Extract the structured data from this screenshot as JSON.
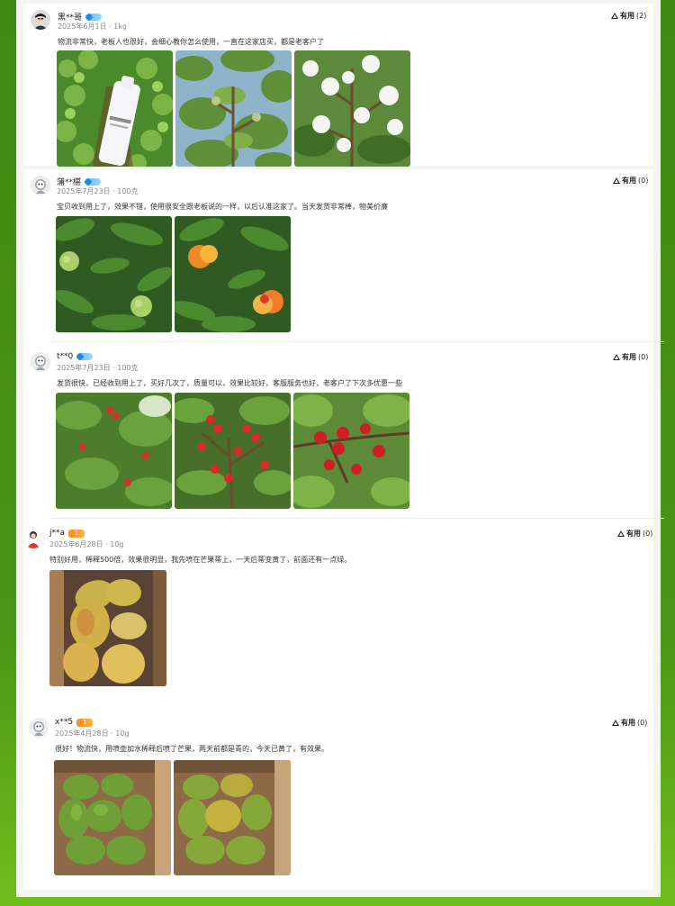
{
  "reviews": [
    {
      "user": "黑**哥",
      "meta": "2025年6月1日 · 1kg",
      "content": "物流非常快，老板人也很好，会细心教你怎么使用，一直在这家店买，都是老客户了",
      "helpful_label": "有用",
      "helpful_count": "(2)",
      "photos": [
        "bottle-in-field",
        "cotton-bolls-green",
        "cotton-bolls-white"
      ]
    },
    {
      "user": "蒲**椹",
      "meta": "2025年7月23日 · 100克",
      "content": "宝贝收到用上了，效果不错，使用很安全跟老板说的一样，以后认准这家了。当天发货非常棒，物美价廉",
      "helpful_label": "有用",
      "helpful_count": "(0)",
      "photos": [
        "green-fruit-tree",
        "ripening-fruit-tree"
      ]
    },
    {
      "user": "t**0",
      "meta": "2025年7月23日 · 100克",
      "content": "发货很快，已经收到用上了，买好几次了，质量可以，效果比较好，客服服务也好，老客户了下次多优惠一些",
      "helpful_label": "有用",
      "helpful_count": "(0)",
      "photos": [
        "cherry-bush",
        "cherry-branches",
        "cherry-closeup"
      ]
    },
    {
      "user": "j**a",
      "badge": "1",
      "meta": "2025年6月28日 · 10g",
      "content": "特别好用，稀释500倍，效果很明显，我先喷在芒果蒂上，一天后蒂变黄了，前面还有一点绿。",
      "helpful_label": "有用",
      "helpful_count": "(0)",
      "photos": [
        "mangoes-in-box"
      ]
    },
    {
      "user": "x**5",
      "badge": "1",
      "meta": "2025年4月28日 · 10g",
      "content": "很好！物流快，用喷壶加水稀释后喷了芒果，两天前都是青的，今天已黄了，有效果。",
      "helpful_label": "有用",
      "helpful_count": "(0)",
      "photos": [
        "green-mangoes-box",
        "yellowing-mangoes-box"
      ]
    }
  ],
  "colors": {
    "border_green": "#3f8a12",
    "text_gray": "#8a8a8a",
    "badge_blue": "#55b6ff",
    "badge_orange": "#ff8a1d"
  }
}
